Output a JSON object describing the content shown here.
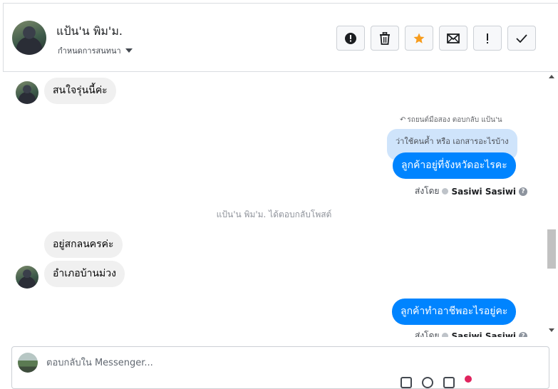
{
  "header": {
    "contact_name": "แป้น'น พิม'ม.",
    "conversation_settings_label": "กำหนดการสนทนา"
  },
  "actions": [
    {
      "name": "report-button",
      "icon": "alert-circle-icon"
    },
    {
      "name": "delete-button",
      "icon": "trash-icon"
    },
    {
      "name": "star-button",
      "icon": "star-icon",
      "color": "#f79c1d"
    },
    {
      "name": "mark-unread-button",
      "icon": "envelope-icon"
    },
    {
      "name": "important-button",
      "icon": "exclamation-icon"
    },
    {
      "name": "done-button",
      "icon": "check-icon"
    }
  ],
  "messages": {
    "in_1": "สนใจรุ่นนี้ค่ะ",
    "reply_hint": "รถยนต์มือสอง ตอบกลับ แป้น'น",
    "quoted_text": "ว่าใช้คนค้ำ หรือ เอกสารอะไรบ้าง",
    "out_1": "ลูกค้าอยู่ที่จังหวัดอะไรคะ",
    "sent_by_prefix": "ส่งโดย",
    "sent_by_name": "Sasiwi Sasiwi",
    "system_note": "แป้น'น พิม'ม. ได้ตอบกลับโพสต์",
    "in_2": "อยู่สกลนครค่ะ",
    "in_3": "อำเภอบ้านม่วง",
    "out_2": "ลูกค้าทำอาชีพอะไรอยู่คะ",
    "sent_by_prefix_2": "ส่งโดย",
    "sent_by_name_2": "Sasiwi Sasiwi"
  },
  "composer": {
    "placeholder": "ตอบกลับใน Messenger..."
  },
  "colors": {
    "outgoing_bubble": "#0084ff",
    "incoming_bubble": "#f0f0f0",
    "quote_bubble": "#cfe4fb",
    "star_accent": "#f79c1d"
  }
}
